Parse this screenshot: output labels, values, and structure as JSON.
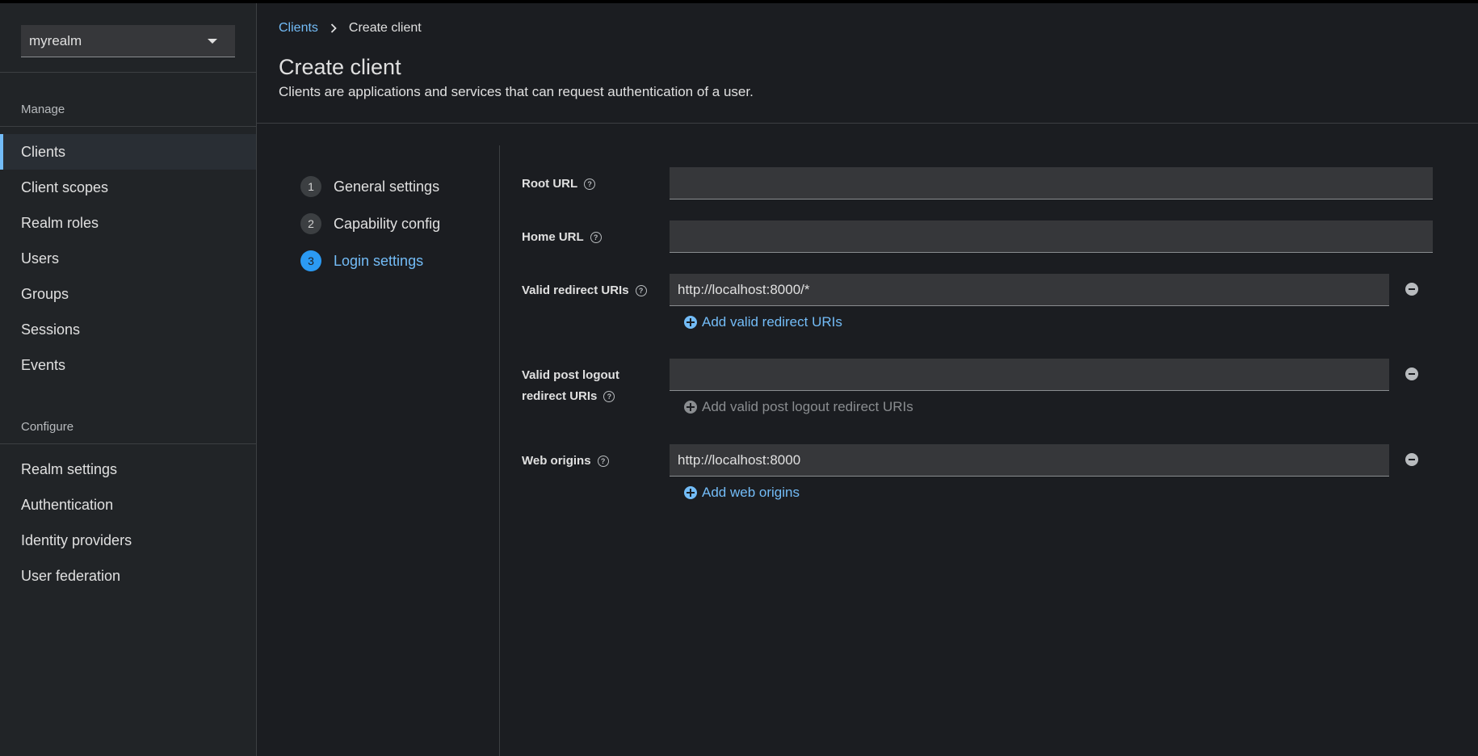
{
  "sidebar": {
    "realm": "myrealm",
    "manage_title": "Manage",
    "manage_items": [
      {
        "label": "Clients",
        "active": true
      },
      {
        "label": "Client scopes"
      },
      {
        "label": "Realm roles"
      },
      {
        "label": "Users"
      },
      {
        "label": "Groups"
      },
      {
        "label": "Sessions"
      },
      {
        "label": "Events"
      }
    ],
    "configure_title": "Configure",
    "configure_items": [
      {
        "label": "Realm settings"
      },
      {
        "label": "Authentication"
      },
      {
        "label": "Identity providers"
      },
      {
        "label": "User federation"
      }
    ]
  },
  "breadcrumb": {
    "parent": "Clients",
    "current": "Create client"
  },
  "page": {
    "title": "Create client",
    "description": "Clients are applications and services that can request authentication of a user."
  },
  "wizard": {
    "steps": [
      {
        "number": "1",
        "label": "General settings"
      },
      {
        "number": "2",
        "label": "Capability config"
      },
      {
        "number": "3",
        "label": "Login settings"
      }
    ],
    "current_step": 3
  },
  "form": {
    "root_url": {
      "label": "Root URL",
      "value": ""
    },
    "home_url": {
      "label": "Home URL",
      "value": ""
    },
    "valid_redirect_uris": {
      "label": "Valid redirect URIs",
      "value": "http://localhost:8000/*",
      "add_label": "Add valid redirect URIs"
    },
    "valid_post_logout": {
      "label_line1": "Valid post logout",
      "label_line2": "redirect URIs",
      "value": "",
      "add_label": "Add valid post logout redirect URIs"
    },
    "web_origins": {
      "label": "Web origins",
      "value": "http://localhost:8000",
      "add_label": "Add web origins"
    }
  },
  "icons": {
    "help": "help-circle-icon",
    "remove": "minus-circle-icon",
    "add": "plus-circle-icon",
    "caret": "caret-down-icon",
    "chevron": "chevron-right-icon"
  },
  "colors": {
    "accent": "#73bcf7",
    "background": "#1b1d21",
    "sidebar": "#212427",
    "input": "#36373a",
    "step_active": "#2b9af3"
  }
}
